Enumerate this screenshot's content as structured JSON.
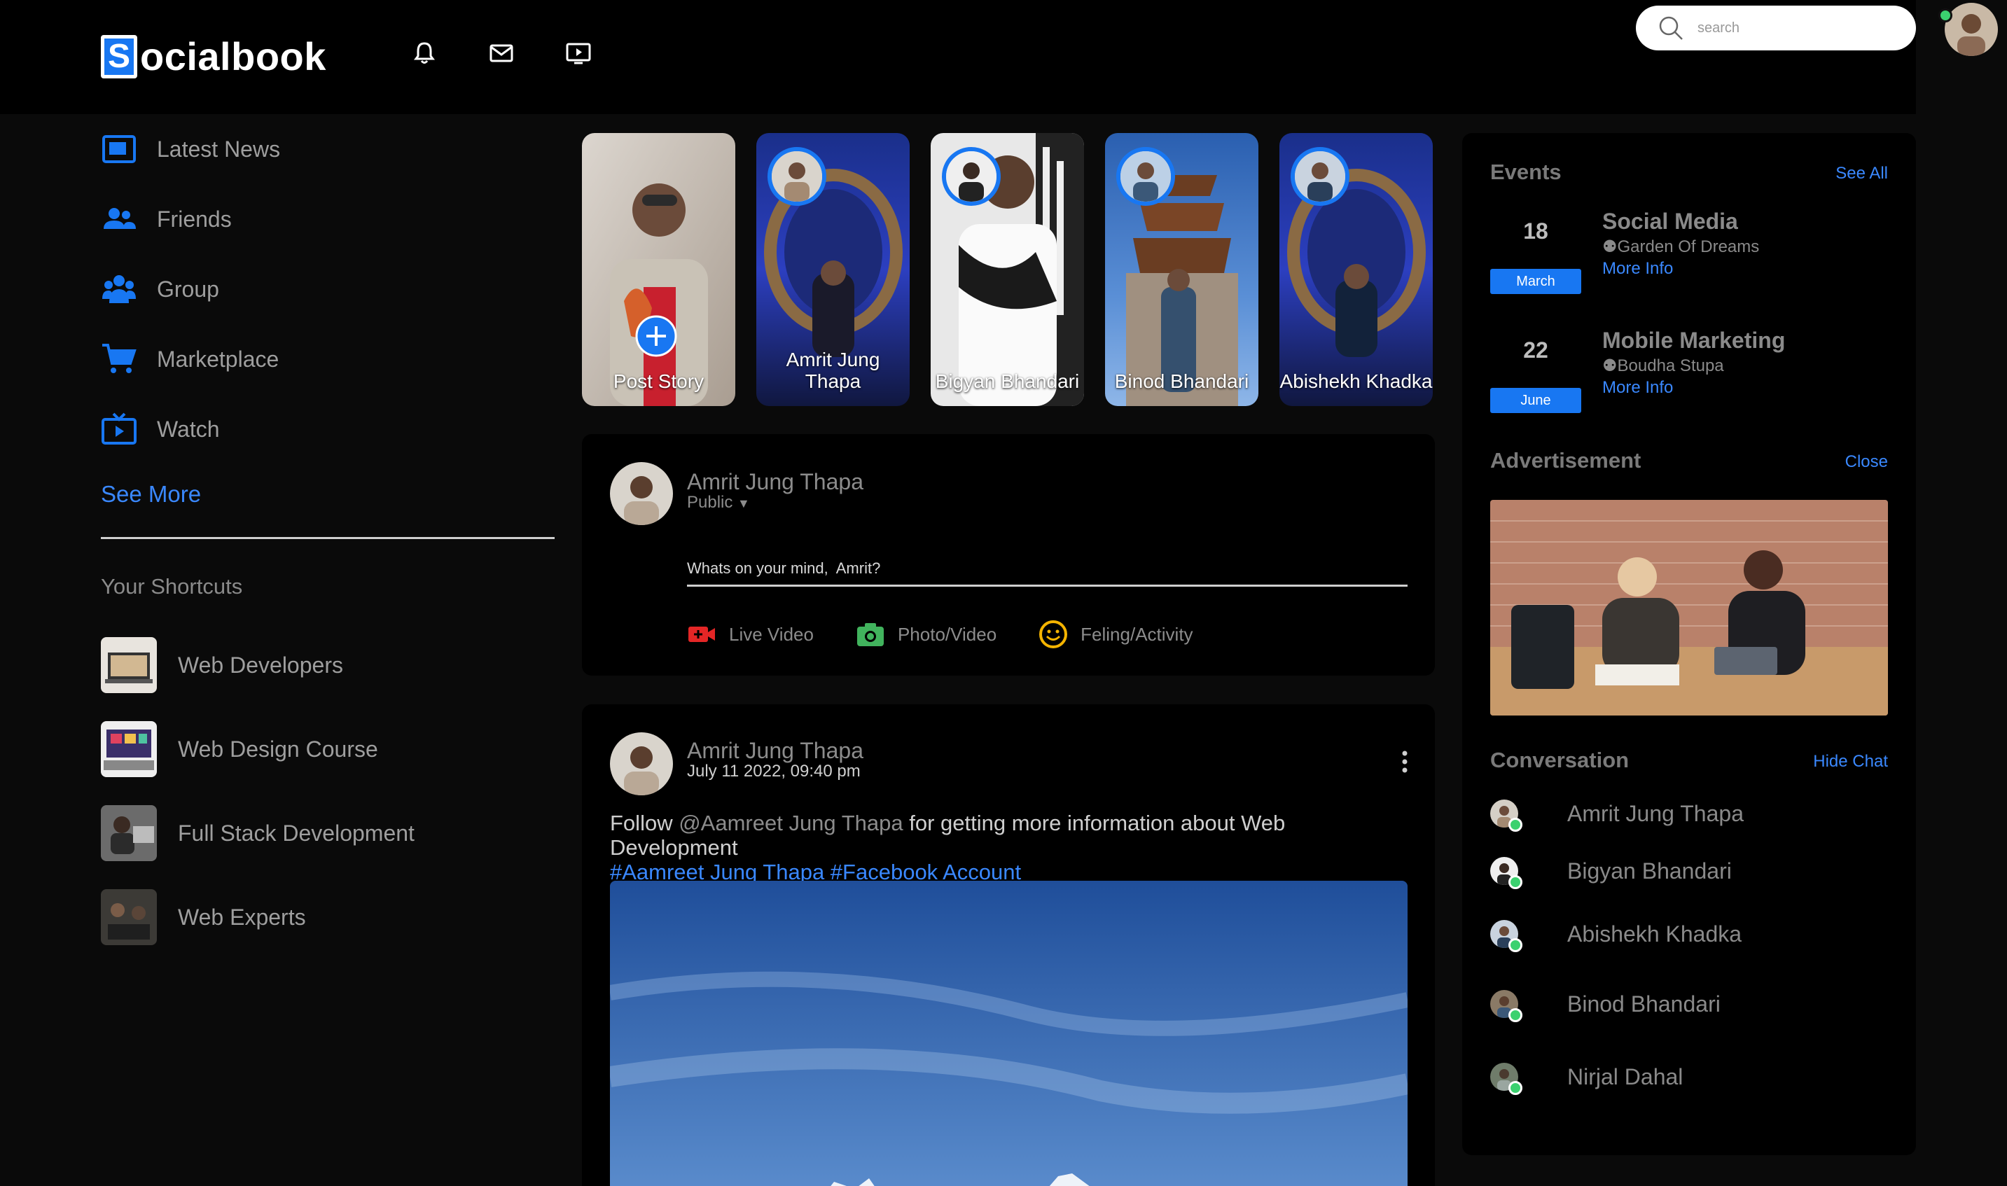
{
  "app": {
    "logo_letter": "S",
    "logo_text": "ocialbook"
  },
  "header": {
    "icons": [
      "bell-icon",
      "mail-icon",
      "video-icon"
    ],
    "search_placeholder": "search"
  },
  "sidebar": {
    "items": [
      {
        "label": "Latest News",
        "icon": "news-icon"
      },
      {
        "label": "Friends",
        "icon": "friends-icon"
      },
      {
        "label": "Group",
        "icon": "group-icon"
      },
      {
        "label": "Marketplace",
        "icon": "cart-icon"
      },
      {
        "label": "Watch",
        "icon": "tv-icon"
      }
    ],
    "see_more": "See More",
    "shortcuts_title": "Your Shortcuts",
    "shortcuts": [
      {
        "label": "Web Developers"
      },
      {
        "label": "Web Design Course"
      },
      {
        "label": "Full Stack Development"
      },
      {
        "label": "Web Experts"
      }
    ]
  },
  "stories": [
    {
      "name": "Post Story"
    },
    {
      "name": "Amrit Jung Thapa"
    },
    {
      "name": "Bigyan Bhandari"
    },
    {
      "name": "Binod Bhandari"
    },
    {
      "name": "Abishekh Khadka"
    }
  ],
  "composer": {
    "name": "Amrit Jung Thapa",
    "privacy": "Public",
    "placeholder": "Whats on your mind,  Amrit?",
    "actions": [
      {
        "label": "Live Video",
        "icon": "live-video-icon",
        "color": "#e42626"
      },
      {
        "label": "Photo/Video",
        "icon": "camera-icon",
        "color": "#41b35d"
      },
      {
        "label": "Feling/Activity",
        "icon": "smile-icon",
        "color": "#f5b400"
      }
    ]
  },
  "post": {
    "author": "Amrit Jung Thapa",
    "date": "July 11 2022, 09:40 pm",
    "text_prefix": "Follow ",
    "mention": "@Aamreet Jung Thapa",
    "text_suffix": " for getting more information about Web Development",
    "tags": "#Aamreet Jung Thapa #Facebook Account"
  },
  "events": {
    "title": "Events",
    "see_all": "See All",
    "items": [
      {
        "day": "18",
        "month": "March",
        "title": "Social Media",
        "location": "Garden Of Dreams",
        "more": "More Info"
      },
      {
        "day": "22",
        "month": "June",
        "title": "Mobile Marketing",
        "location": "Boudha Stupa",
        "more": "More Info"
      }
    ]
  },
  "advertisement": {
    "title": "Advertisement",
    "close": "Close"
  },
  "conversation": {
    "title": "Conversation",
    "hide": "Hide Chat",
    "items": [
      {
        "name": "Amrit Jung Thapa"
      },
      {
        "name": "Bigyan Bhandari"
      },
      {
        "name": "Abishekh Khadka"
      },
      {
        "name": "Binod Bhandari"
      },
      {
        "name": "Nirjal Dahal"
      }
    ]
  },
  "colors": {
    "accent": "#1877f2",
    "link": "#3a88ff",
    "online": "#3bd16f"
  }
}
